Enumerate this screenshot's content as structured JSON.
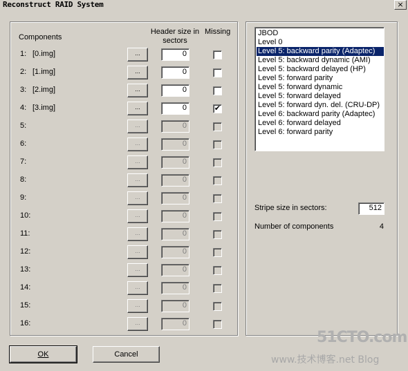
{
  "window": {
    "title": "Reconstruct RAID System",
    "close_glyph": "×"
  },
  "columns": {
    "components": "Components",
    "header_size_line1": "Header size in",
    "header_size_line2": "sectors",
    "missing": "Missing"
  },
  "rows": [
    {
      "num": "1:",
      "name": "[0.img]",
      "browse": "...",
      "header": "0",
      "missing": false,
      "enabled": true
    },
    {
      "num": "2:",
      "name": "[1.img]",
      "browse": "...",
      "header": "0",
      "missing": false,
      "enabled": true
    },
    {
      "num": "3:",
      "name": "[2.img]",
      "browse": "...",
      "header": "0",
      "missing": false,
      "enabled": true
    },
    {
      "num": "4:",
      "name": "[3.img]",
      "browse": "...",
      "header": "0",
      "missing": true,
      "enabled": true
    },
    {
      "num": "5:",
      "name": "",
      "browse": "...",
      "header": "0",
      "missing": false,
      "enabled": false
    },
    {
      "num": "6:",
      "name": "",
      "browse": "...",
      "header": "0",
      "missing": false,
      "enabled": false
    },
    {
      "num": "7:",
      "name": "",
      "browse": "...",
      "header": "0",
      "missing": false,
      "enabled": false
    },
    {
      "num": "8:",
      "name": "",
      "browse": "...",
      "header": "0",
      "missing": false,
      "enabled": false
    },
    {
      "num": "9:",
      "name": "",
      "browse": "...",
      "header": "0",
      "missing": false,
      "enabled": false
    },
    {
      "num": "10:",
      "name": "",
      "browse": "...",
      "header": "0",
      "missing": false,
      "enabled": false
    },
    {
      "num": "11:",
      "name": "",
      "browse": "...",
      "header": "0",
      "missing": false,
      "enabled": false
    },
    {
      "num": "12:",
      "name": "",
      "browse": "...",
      "header": "0",
      "missing": false,
      "enabled": false
    },
    {
      "num": "13:",
      "name": "",
      "browse": "...",
      "header": "0",
      "missing": false,
      "enabled": false
    },
    {
      "num": "14:",
      "name": "",
      "browse": "...",
      "header": "0",
      "missing": false,
      "enabled": false
    },
    {
      "num": "15:",
      "name": "",
      "browse": "...",
      "header": "0",
      "missing": false,
      "enabled": false
    },
    {
      "num": "16:",
      "name": "",
      "browse": "...",
      "header": "0",
      "missing": false,
      "enabled": false
    }
  ],
  "raid_levels": {
    "items": [
      "JBOD",
      "Level 0",
      "Level 5: backward parity (Adaptec)",
      "Level 5: backward dynamic (AMI)",
      "Level 5: backward delayed (HP)",
      "Level 5: forward parity",
      "Level 5: forward dynamic",
      "Level 5: forward delayed",
      "Level 5: forward dyn. del. (CRU-DP)",
      "Level 6: backward parity (Adaptec)",
      "Level 6: forward delayed",
      "Level 6: forward parity"
    ],
    "selected": "Level 5: backward parity (Adaptec)"
  },
  "stripe": {
    "label": "Stripe size in sectors:",
    "value": "512"
  },
  "num_components": {
    "label": "Number of components",
    "value": "4"
  },
  "buttons": {
    "ok": "OK",
    "cancel": "Cancel"
  },
  "watermark": {
    "line1": "51CTO.com",
    "line2": "www.技术博客.net Blog"
  },
  "colors": {
    "selection": "#0a246a",
    "face": "#d4d0c8",
    "disabled_text": "#808080"
  }
}
